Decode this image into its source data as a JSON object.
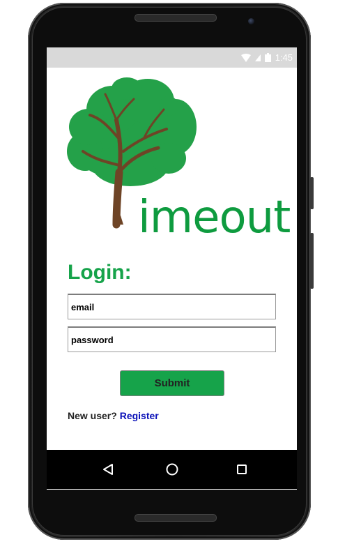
{
  "status_bar": {
    "time": "1:45",
    "icons": [
      "wifi-icon",
      "signal-icon",
      "battery-icon"
    ]
  },
  "logo": {
    "text": "imeout",
    "icon": "tree-icon",
    "color": "#0e9b3f"
  },
  "login": {
    "title": "Login:",
    "email_placeholder": "email",
    "password_placeholder": "password",
    "submit_label": "Submit",
    "new_user_text": "New user?",
    "register_label": "Register"
  },
  "nav_bar": {
    "icons": [
      "back-icon",
      "home-icon",
      "recents-icon"
    ]
  },
  "colors": {
    "accent_green": "#16a34a",
    "link_blue": "#0a10b8",
    "status_bar_bg": "#d9d9d9"
  }
}
